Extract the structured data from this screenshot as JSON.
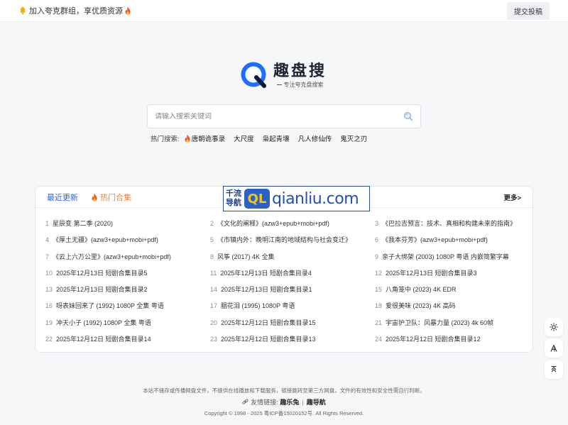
{
  "topbar": {
    "notice": "加入夸克群组，享优质资源",
    "submit_label": "提交投稿"
  },
  "logo": {
    "title": "趣盘搜",
    "subtitle": "专注夸克盘搜索"
  },
  "search": {
    "placeholder": "请输入搜索关键词"
  },
  "hot": {
    "label": "热门搜索:",
    "items": [
      "唐朝诡事录",
      "大尺度",
      "枭起青壤",
      "凡人修仙传",
      "鬼灭之刃"
    ]
  },
  "panel": {
    "tabs": [
      "最近更新",
      "热门合集"
    ],
    "more": "更多>",
    "items": [
      {
        "n": "1",
        "t": "星辰变 第二季 (2020)"
      },
      {
        "n": "2",
        "t": "《文化的阐释》(azw3+epub+mobi+pdf)"
      },
      {
        "n": "3",
        "t": "《巴拉吉预言：技术、真相和构建未来的指南》"
      },
      {
        "n": "4",
        "t": "《厚土无疆》(azw3+epub+mobi+pdf)"
      },
      {
        "n": "5",
        "t": "《市镇内外：晚明江南的地域结构与社会变迁》"
      },
      {
        "n": "6",
        "t": "《我本芬芳》(azw3+epub+mobi+pdf)"
      },
      {
        "n": "7",
        "t": "《云上六万公里》(azw3+epub+mobi+pdf)"
      },
      {
        "n": "8",
        "t": "风筝 (2017) 4K 全集"
      },
      {
        "n": "9",
        "t": "亲子大绑架 (2003) 1080P 粤语 内嵌简繁字幕"
      },
      {
        "n": "10",
        "t": "2025年12月13日 短剧合集目录5"
      },
      {
        "n": "11",
        "t": "2025年12月13日 短剧合集目录4"
      },
      {
        "n": "12",
        "t": "2025年12月13日 短剧合集目录3"
      },
      {
        "n": "13",
        "t": "2025年12月13日 短剧合集目录2"
      },
      {
        "n": "14",
        "t": "2025年12月13日 短剧合集目录1"
      },
      {
        "n": "15",
        "t": "八角笼中 (2023) 4K EDR"
      },
      {
        "n": "16",
        "t": "呀表妹回来了 (1992) 1080P 全集 粤语"
      },
      {
        "n": "17",
        "t": "胭花泪 (1995) 1080P 粤语"
      },
      {
        "n": "18",
        "t": "爱很美味 (2023) 4K 高码"
      },
      {
        "n": "19",
        "t": "冲天小子 (1992) 1080P 全集 粤语"
      },
      {
        "n": "20",
        "t": "2025年12月12日 短剧合集目录15"
      },
      {
        "n": "21",
        "t": "宇宙护卫队：风暴力量 (2023) 4k 60帧"
      },
      {
        "n": "22",
        "t": "2025年12月12日 短剧合集目录14"
      },
      {
        "n": "23",
        "t": "2025年12月12日 短剧合集目录13"
      },
      {
        "n": "24",
        "t": "2025年12月12日 短剧合集目录12"
      }
    ]
  },
  "ad": {
    "cn_line1": "千流",
    "cn_line2": "导航",
    "badge": "QL",
    "domain": "qianliu.com"
  },
  "footer": {
    "disclaimer": "本站不储存或传播网盘文件，不提供在线播放和下载服务，链接跳转至第三方网盘，文件的有效性和安全性需自行判断。",
    "links_label": "友情链接:",
    "links": [
      "趣乐兔",
      "趣导航"
    ],
    "copyright": "Copyright © 1998 - 2025 粤ICP备15020152号. All Rights Reserved."
  },
  "colors": {
    "accent": "#2563eb",
    "hot_tab": "#f0843c",
    "logo_blue": "#1e6fff"
  }
}
